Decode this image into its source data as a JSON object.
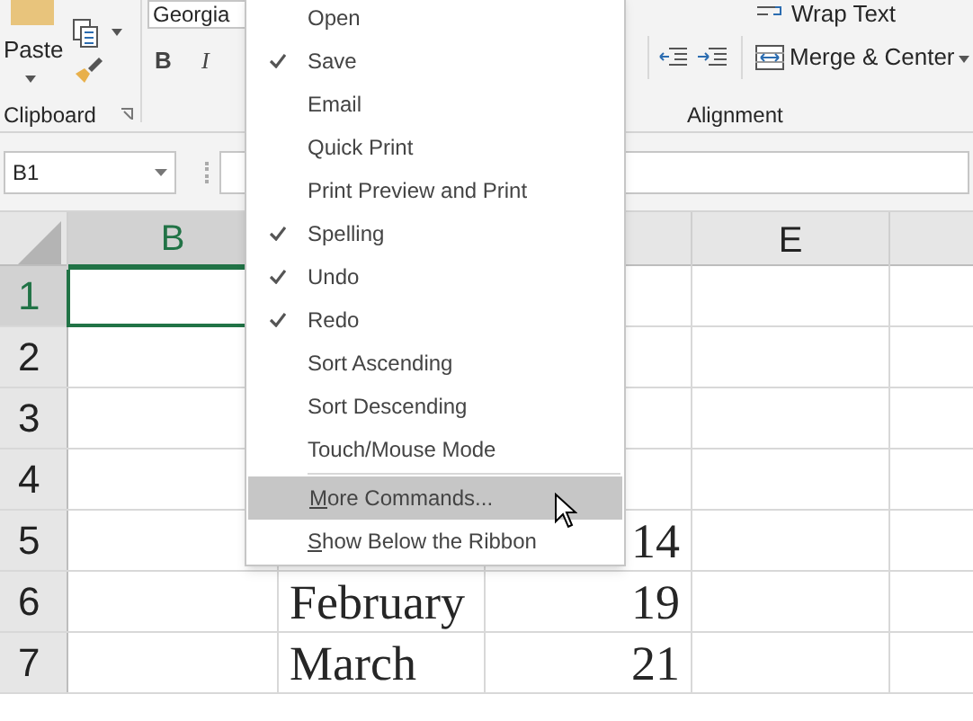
{
  "ribbon": {
    "clipboard": {
      "paste_label": "Paste",
      "group_label": "Clipboard"
    },
    "font": {
      "font_name": "Georgia",
      "bold_label": "B",
      "italic_label": "I"
    },
    "alignment": {
      "wrap_text": "Wrap Text",
      "merge_center": "Merge & Center",
      "group_label": "Alignment"
    }
  },
  "name_box": "B1",
  "grid": {
    "column_b": {
      "label": "B",
      "selected": true
    },
    "column_e": {
      "label": "E",
      "selected": false
    },
    "rows": [
      {
        "header": "1",
        "selected": true
      },
      {
        "header": "2",
        "selected": false
      },
      {
        "header": "3",
        "selected": false
      },
      {
        "header": "4",
        "selected": false
      },
      {
        "header": "5",
        "selected": false,
        "value": "14"
      },
      {
        "header": "6",
        "selected": false,
        "month": "February",
        "value": "19"
      },
      {
        "header": "7",
        "selected": false,
        "month": "March",
        "value": "21"
      }
    ]
  },
  "menu": [
    {
      "label": "Open",
      "checked": false,
      "highlighted": false
    },
    {
      "label": "Save",
      "checked": true,
      "highlighted": false
    },
    {
      "label": "Email",
      "checked": false,
      "highlighted": false
    },
    {
      "label": "Quick Print",
      "checked": false,
      "highlighted": false
    },
    {
      "label": "Print Preview and Print",
      "checked": false,
      "highlighted": false
    },
    {
      "label": "Spelling",
      "checked": true,
      "highlighted": false
    },
    {
      "label": "Undo",
      "checked": true,
      "highlighted": false
    },
    {
      "label": "Redo",
      "checked": true,
      "highlighted": false
    },
    {
      "label": "Sort Ascending",
      "checked": false,
      "highlighted": false
    },
    {
      "label": "Sort Descending",
      "checked": false,
      "highlighted": false
    },
    {
      "label": "Touch/Mouse Mode",
      "checked": false,
      "highlighted": false
    },
    {
      "label": "More Commands...",
      "checked": false,
      "highlighted": true,
      "separator_before": true,
      "accelerator": true
    },
    {
      "label": "Show Below the Ribbon",
      "checked": false,
      "highlighted": false,
      "accelerator": true
    }
  ]
}
